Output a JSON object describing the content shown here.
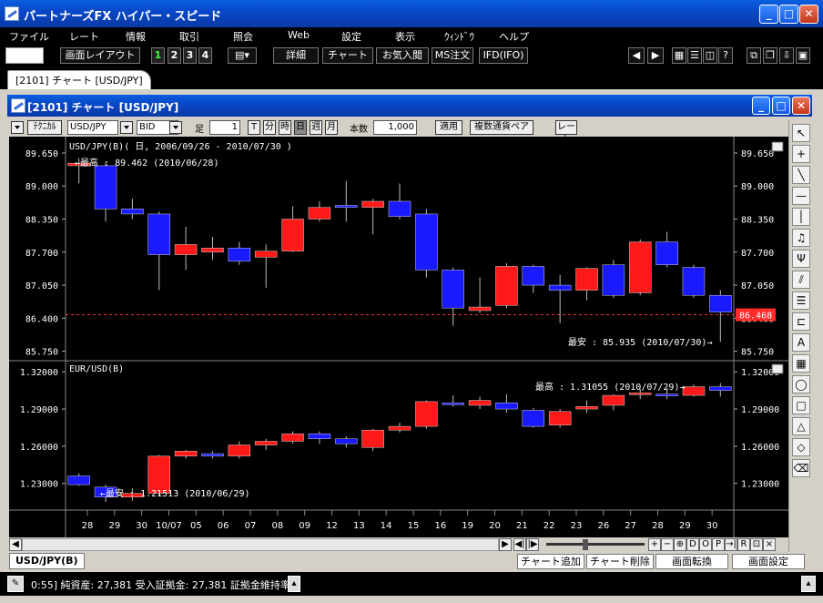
{
  "app": {
    "title": "パートナーズFX ハイパー・スピード"
  },
  "menu": [
    "ファイル",
    "レート",
    "情報",
    "取引",
    "照会",
    "Web",
    "設定",
    "表示",
    "ｳｨﾝﾄﾞｳ",
    "ヘルプ"
  ],
  "toolbar": {
    "layout_label": "画面レイアウト",
    "numbers": [
      "1",
      "2",
      "3",
      "4"
    ],
    "buttons": [
      "詳細",
      "チャート",
      "お気入閲",
      "MS注文",
      "IFD(IFO)"
    ]
  },
  "main_tab": "[2101] チャート [USD/JPY]",
  "chart_window": {
    "title": "[2101] チャート [USD/JPY]",
    "controls": {
      "technical": "ﾃｸﾆｶﾙ",
      "pair": "USD/JPY",
      "side": "BID",
      "ashi_label": "足",
      "ashi_value": "1",
      "timeframes": [
        "T",
        "分",
        "時",
        "日",
        "週",
        "月"
      ],
      "count_label": "本数",
      "count_value": "1,000",
      "apply": "適用",
      "multi_pair": "複数通貨ペア",
      "rate": "レート"
    }
  },
  "chart_data": [
    {
      "type": "candlestick",
      "title": "USD/JPY(B)( 日, 2006/09/26 - 2010/07/30 )",
      "y_ticks": [
        "89.650",
        "89.000",
        "88.350",
        "87.700",
        "87.050",
        "86.400",
        "85.750"
      ],
      "ylim": [
        85.6,
        89.9
      ],
      "current_price": "86.468",
      "current_value": 86.468,
      "annotations": {
        "high": "←最高 : 89.462 (2010/06/28)",
        "low": "最安 : 85.935 (2010/07/30)→"
      },
      "candles": [
        {
          "o": 89.45,
          "c": 89.4,
          "h": 89.55,
          "l": 89.05,
          "color": "red"
        },
        {
          "o": 89.4,
          "c": 88.55,
          "h": 89.46,
          "l": 88.3,
          "color": "blue"
        },
        {
          "o": 88.55,
          "c": 88.45,
          "h": 88.75,
          "l": 88.35,
          "color": "blue"
        },
        {
          "o": 88.45,
          "c": 87.65,
          "h": 88.5,
          "l": 86.95,
          "color": "blue"
        },
        {
          "o": 87.65,
          "c": 87.85,
          "h": 88.2,
          "l": 87.35,
          "color": "red"
        },
        {
          "o": 87.7,
          "c": 87.78,
          "h": 88.0,
          "l": 87.55,
          "color": "red"
        },
        {
          "o": 87.78,
          "c": 87.52,
          "h": 87.9,
          "l": 87.45,
          "color": "blue"
        },
        {
          "o": 87.6,
          "c": 87.72,
          "h": 87.85,
          "l": 87.0,
          "color": "red"
        },
        {
          "o": 87.72,
          "c": 88.35,
          "h": 88.6,
          "l": 87.7,
          "color": "red"
        },
        {
          "o": 88.35,
          "c": 88.58,
          "h": 88.7,
          "l": 88.3,
          "color": "red"
        },
        {
          "o": 88.58,
          "c": 88.62,
          "h": 89.1,
          "l": 88.3,
          "color": "blue"
        },
        {
          "o": 88.58,
          "c": 88.7,
          "h": 88.75,
          "l": 88.05,
          "color": "red"
        },
        {
          "o": 88.7,
          "c": 88.4,
          "h": 89.05,
          "l": 88.35,
          "color": "blue"
        },
        {
          "o": 88.45,
          "c": 87.35,
          "h": 88.55,
          "l": 87.2,
          "color": "blue"
        },
        {
          "o": 87.35,
          "c": 86.6,
          "h": 87.4,
          "l": 86.25,
          "color": "blue"
        },
        {
          "o": 86.55,
          "c": 86.62,
          "h": 87.2,
          "l": 86.5,
          "color": "red"
        },
        {
          "o": 86.65,
          "c": 87.42,
          "h": 87.48,
          "l": 86.6,
          "color": "red"
        },
        {
          "o": 87.42,
          "c": 87.05,
          "h": 87.45,
          "l": 86.9,
          "color": "blue"
        },
        {
          "o": 87.05,
          "c": 86.95,
          "h": 87.25,
          "l": 86.3,
          "color": "blue"
        },
        {
          "o": 86.95,
          "c": 87.38,
          "h": 87.4,
          "l": 86.75,
          "color": "red"
        },
        {
          "o": 87.45,
          "c": 86.85,
          "h": 87.55,
          "l": 86.8,
          "color": "blue"
        },
        {
          "o": 86.9,
          "c": 87.9,
          "h": 87.95,
          "l": 86.85,
          "color": "red"
        },
        {
          "o": 87.9,
          "c": 87.45,
          "h": 88.1,
          "l": 87.4,
          "color": "blue"
        },
        {
          "o": 87.4,
          "c": 86.85,
          "h": 87.45,
          "l": 86.8,
          "color": "blue"
        },
        {
          "o": 86.85,
          "c": 86.52,
          "h": 86.95,
          "l": 85.935,
          "color": "blue"
        }
      ]
    },
    {
      "type": "candlestick",
      "title": "EUR/USD(B)",
      "y_ticks": [
        "1.32000",
        "1.29000",
        "1.26000",
        "1.23000"
      ],
      "ylim": [
        1.2085,
        1.3275
      ],
      "annotations": {
        "high": "最高 : 1.31055 (2010/07/29)→",
        "low": "←最安 : 1.21513 (2010/06/29)"
      },
      "candles": [
        {
          "o": 1.236,
          "c": 1.229,
          "h": 1.238,
          "l": 1.228,
          "color": "blue"
        },
        {
          "o": 1.227,
          "c": 1.219,
          "h": 1.229,
          "l": 1.215,
          "color": "blue"
        },
        {
          "o": 1.219,
          "c": 1.222,
          "h": 1.226,
          "l": 1.216,
          "color": "red"
        },
        {
          "o": 1.222,
          "c": 1.252,
          "h": 1.253,
          "l": 1.22,
          "color": "red"
        },
        {
          "o": 1.252,
          "c": 1.256,
          "h": 1.257,
          "l": 1.25,
          "color": "red"
        },
        {
          "o": 1.254,
          "c": 1.252,
          "h": 1.256,
          "l": 1.25,
          "color": "blue"
        },
        {
          "o": 1.252,
          "c": 1.261,
          "h": 1.264,
          "l": 1.25,
          "color": "red"
        },
        {
          "o": 1.261,
          "c": 1.264,
          "h": 1.266,
          "l": 1.257,
          "color": "red"
        },
        {
          "o": 1.264,
          "c": 1.27,
          "h": 1.272,
          "l": 1.262,
          "color": "red"
        },
        {
          "o": 1.27,
          "c": 1.266,
          "h": 1.272,
          "l": 1.262,
          "color": "blue"
        },
        {
          "o": 1.266,
          "c": 1.262,
          "h": 1.268,
          "l": 1.259,
          "color": "blue"
        },
        {
          "o": 1.259,
          "c": 1.273,
          "h": 1.274,
          "l": 1.256,
          "color": "red"
        },
        {
          "o": 1.273,
          "c": 1.276,
          "h": 1.279,
          "l": 1.271,
          "color": "red"
        },
        {
          "o": 1.276,
          "c": 1.296,
          "h": 1.297,
          "l": 1.274,
          "color": "red"
        },
        {
          "o": 1.295,
          "c": 1.294,
          "h": 1.301,
          "l": 1.292,
          "color": "blue"
        },
        {
          "o": 1.293,
          "c": 1.297,
          "h": 1.3,
          "l": 1.29,
          "color": "red"
        },
        {
          "o": 1.295,
          "c": 1.29,
          "h": 1.302,
          "l": 1.287,
          "color": "blue"
        },
        {
          "o": 1.289,
          "c": 1.276,
          "h": 1.291,
          "l": 1.275,
          "color": "blue"
        },
        {
          "o": 1.277,
          "c": 1.288,
          "h": 1.29,
          "l": 1.275,
          "color": "red"
        },
        {
          "o": 1.29,
          "c": 1.292,
          "h": 1.297,
          "l": 1.287,
          "color": "red"
        },
        {
          "o": 1.293,
          "c": 1.301,
          "h": 1.302,
          "l": 1.289,
          "color": "red"
        },
        {
          "o": 1.302,
          "c": 1.303,
          "h": 1.306,
          "l": 1.298,
          "color": "red"
        },
        {
          "o": 1.302,
          "c": 1.302,
          "h": 1.307,
          "l": 1.298,
          "color": "blue"
        },
        {
          "o": 1.301,
          "c": 1.308,
          "h": 1.31,
          "l": 1.3,
          "color": "red"
        },
        {
          "o": 1.308,
          "c": 1.305,
          "h": 1.311,
          "l": 1.3,
          "color": "blue"
        }
      ]
    }
  ],
  "x_labels": [
    "28",
    "29",
    "30",
    "10/07",
    "05",
    "06",
    "07",
    "08",
    "09",
    "12",
    "13",
    "14",
    "15",
    "16",
    "19",
    "20",
    "21",
    "22",
    "23",
    "26",
    "27",
    "28",
    "29",
    "30"
  ],
  "scroll_buttons": [
    "+",
    "−",
    "⊕",
    "D",
    "O",
    "P",
    "→|",
    "R",
    "⊡",
    "×"
  ],
  "bottom": {
    "pair_tab": "USD/JPY(B)",
    "buttons": [
      "チャート追加",
      "チャート削除",
      "画面転換",
      "画面設定"
    ]
  },
  "status": {
    "text": "0:55] 純資産: 27,381  受入証拠金: 27,381  証拠金維持率:"
  },
  "colors": {
    "up": "#ff1a1a",
    "down": "#1a1aff",
    "bg": "#000000",
    "title_blue": "#0848c8"
  }
}
